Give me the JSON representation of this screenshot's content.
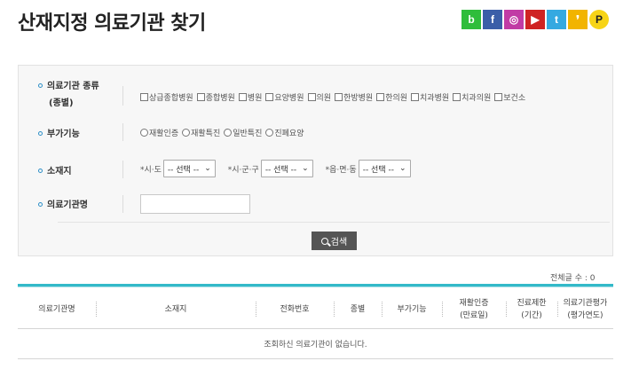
{
  "page_title": "산재지정 의료기관 찾기",
  "sns": [
    {
      "name": "band-icon",
      "glyph": "b",
      "color": "#2fbd3b"
    },
    {
      "name": "facebook-icon",
      "glyph": "f",
      "color": "#3b5ea8"
    },
    {
      "name": "instagram-icon",
      "glyph": "◎",
      "color": "#c13ba5"
    },
    {
      "name": "youtube-icon",
      "glyph": "▶",
      "color": "#cf2323"
    },
    {
      "name": "twitter-icon",
      "glyph": "t",
      "color": "#35a9e1"
    },
    {
      "name": "kakaostory-icon",
      "glyph": "❜",
      "color": "#f2b400"
    },
    {
      "name": "kakao-plus-icon",
      "glyph": "P",
      "color": "#f7d417"
    }
  ],
  "search": {
    "type_label_1": "의료기관 종류",
    "type_label_2": "(종별)",
    "types": [
      "상급종합병원",
      "종합병원",
      "병원",
      "요양병원",
      "의원",
      "한방병원",
      "한의원",
      "치과병원",
      "치과의원",
      "보건소"
    ],
    "func_label": "부가기능",
    "funcs": [
      "재활인증",
      "재활특진",
      "일반특진",
      "진폐요양"
    ],
    "loc_label": "소재지",
    "loc": [
      {
        "label": "*시·도",
        "value": "-- 선택 --"
      },
      {
        "label": "*시·군·구",
        "value": "-- 선택 --"
      },
      {
        "label": "*읍·면·동",
        "value": "-- 선택 --"
      }
    ],
    "name_label": "의료기관명",
    "name_value": "",
    "button_label": "검색"
  },
  "total_label": "전체글 수 : 0",
  "table": {
    "headers": [
      {
        "l1": "의료기관명",
        "l2": ""
      },
      {
        "l1": "소재지",
        "l2": ""
      },
      {
        "l1": "전화번호",
        "l2": ""
      },
      {
        "l1": "종별",
        "l2": ""
      },
      {
        "l1": "부가기능",
        "l2": ""
      },
      {
        "l1": "재활인증",
        "l2": "(만료일)"
      },
      {
        "l1": "진료제한",
        "l2": "(기간)"
      },
      {
        "l1": "의료기관평가",
        "l2": "(평가연도)"
      }
    ],
    "empty_message": "조회하신 의료기관이 없습니다."
  }
}
